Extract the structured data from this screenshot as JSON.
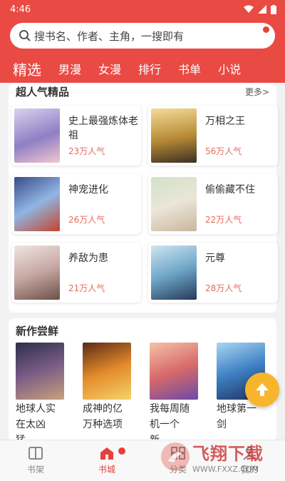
{
  "status": {
    "time": "4:46"
  },
  "search": {
    "placeholder": "搜书名、作者、主角，一搜即有"
  },
  "tabs": [
    "精选",
    "男漫",
    "女漫",
    "排行",
    "书单",
    "小说"
  ],
  "featured": {
    "title": "超人气精品",
    "more": "更多>",
    "items": [
      {
        "title": "史上最强炼体老祖",
        "popularity": "23万人气"
      },
      {
        "title": "万相之王",
        "popularity": "56万人气"
      },
      {
        "title": "神宠进化",
        "popularity": "26万人气"
      },
      {
        "title": "偷偷藏不住",
        "popularity": "22万人气"
      },
      {
        "title": "养敌为患",
        "popularity": "21万人气"
      },
      {
        "title": "元尊",
        "popularity": "28万人气"
      }
    ]
  },
  "new_section": {
    "title": "新作尝鲜",
    "items": [
      {
        "title": "地球人实在太凶猛..."
      },
      {
        "title": "成神的亿万种选项"
      },
      {
        "title": "我每周随机一个新..."
      },
      {
        "title": "地球第一剑"
      }
    ]
  },
  "bottom_nav": [
    {
      "label": "书架",
      "icon": "bookshelf-icon"
    },
    {
      "label": "书城",
      "icon": "home-icon"
    },
    {
      "label": "分类",
      "icon": "category-icon"
    },
    {
      "label": "我的",
      "icon": "profile-icon"
    }
  ],
  "watermark": {
    "text": "飞翔下载",
    "url": "WWW.FXXZ.COM"
  },
  "colors": {
    "accent": "#ea4a44",
    "popularity": "#e66a5c",
    "fab": "#f6b52c"
  }
}
